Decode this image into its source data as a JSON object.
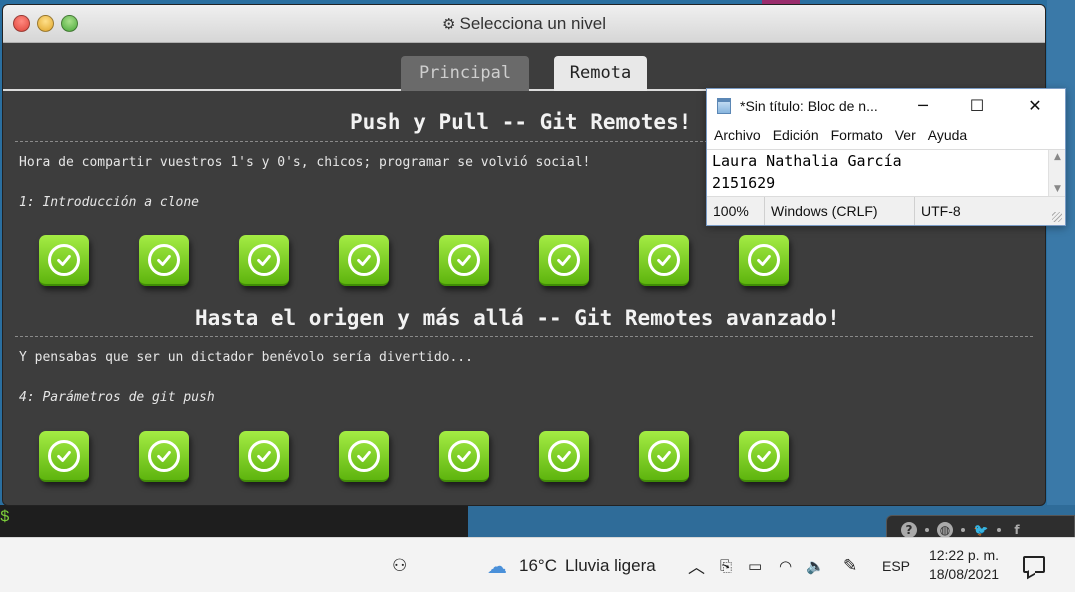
{
  "app": {
    "title": "Selecciona un nivel",
    "tabs": [
      "Principal",
      "Remota"
    ],
    "active_tab": "Remota"
  },
  "sections": [
    {
      "title": "Push y Pull -- Git Remotes!",
      "description": "Hora de compartir vuestros 1's y 0's, chicos; programar se volvió social!",
      "subtitle": "1: Introducción a clone",
      "levels_completed": 8
    },
    {
      "title": "Hasta el origen y más allá -- Git Remotes avanzado!",
      "description": "Y pensabas que ser un dictador benévolo sería divertido...",
      "subtitle": "4: Parámetros de git push",
      "levels_completed": 8
    }
  ],
  "notepad": {
    "title": "*Sin título: Bloc de n...",
    "menu": [
      "Archivo",
      "Edición",
      "Formato",
      "Ver",
      "Ayuda"
    ],
    "lines": [
      "Laura Nathalia García",
      "2151629"
    ],
    "status": {
      "zoom": "100%",
      "line_endings": "Windows (CRLF)",
      "encoding": "UTF-8"
    }
  },
  "background": {
    "prompt": "$"
  },
  "taskbar": {
    "weather_temp": "16°C",
    "weather_desc": "Lluvia ligera",
    "language": "ESP",
    "time": "12:22 p. m.",
    "date": "18/08/2021"
  },
  "colors": {
    "level_green": "#7ccf22",
    "window_bg": "#3d3d3d",
    "tab_active": "#e8e8e8",
    "tab_inactive": "#6a6a6a"
  }
}
